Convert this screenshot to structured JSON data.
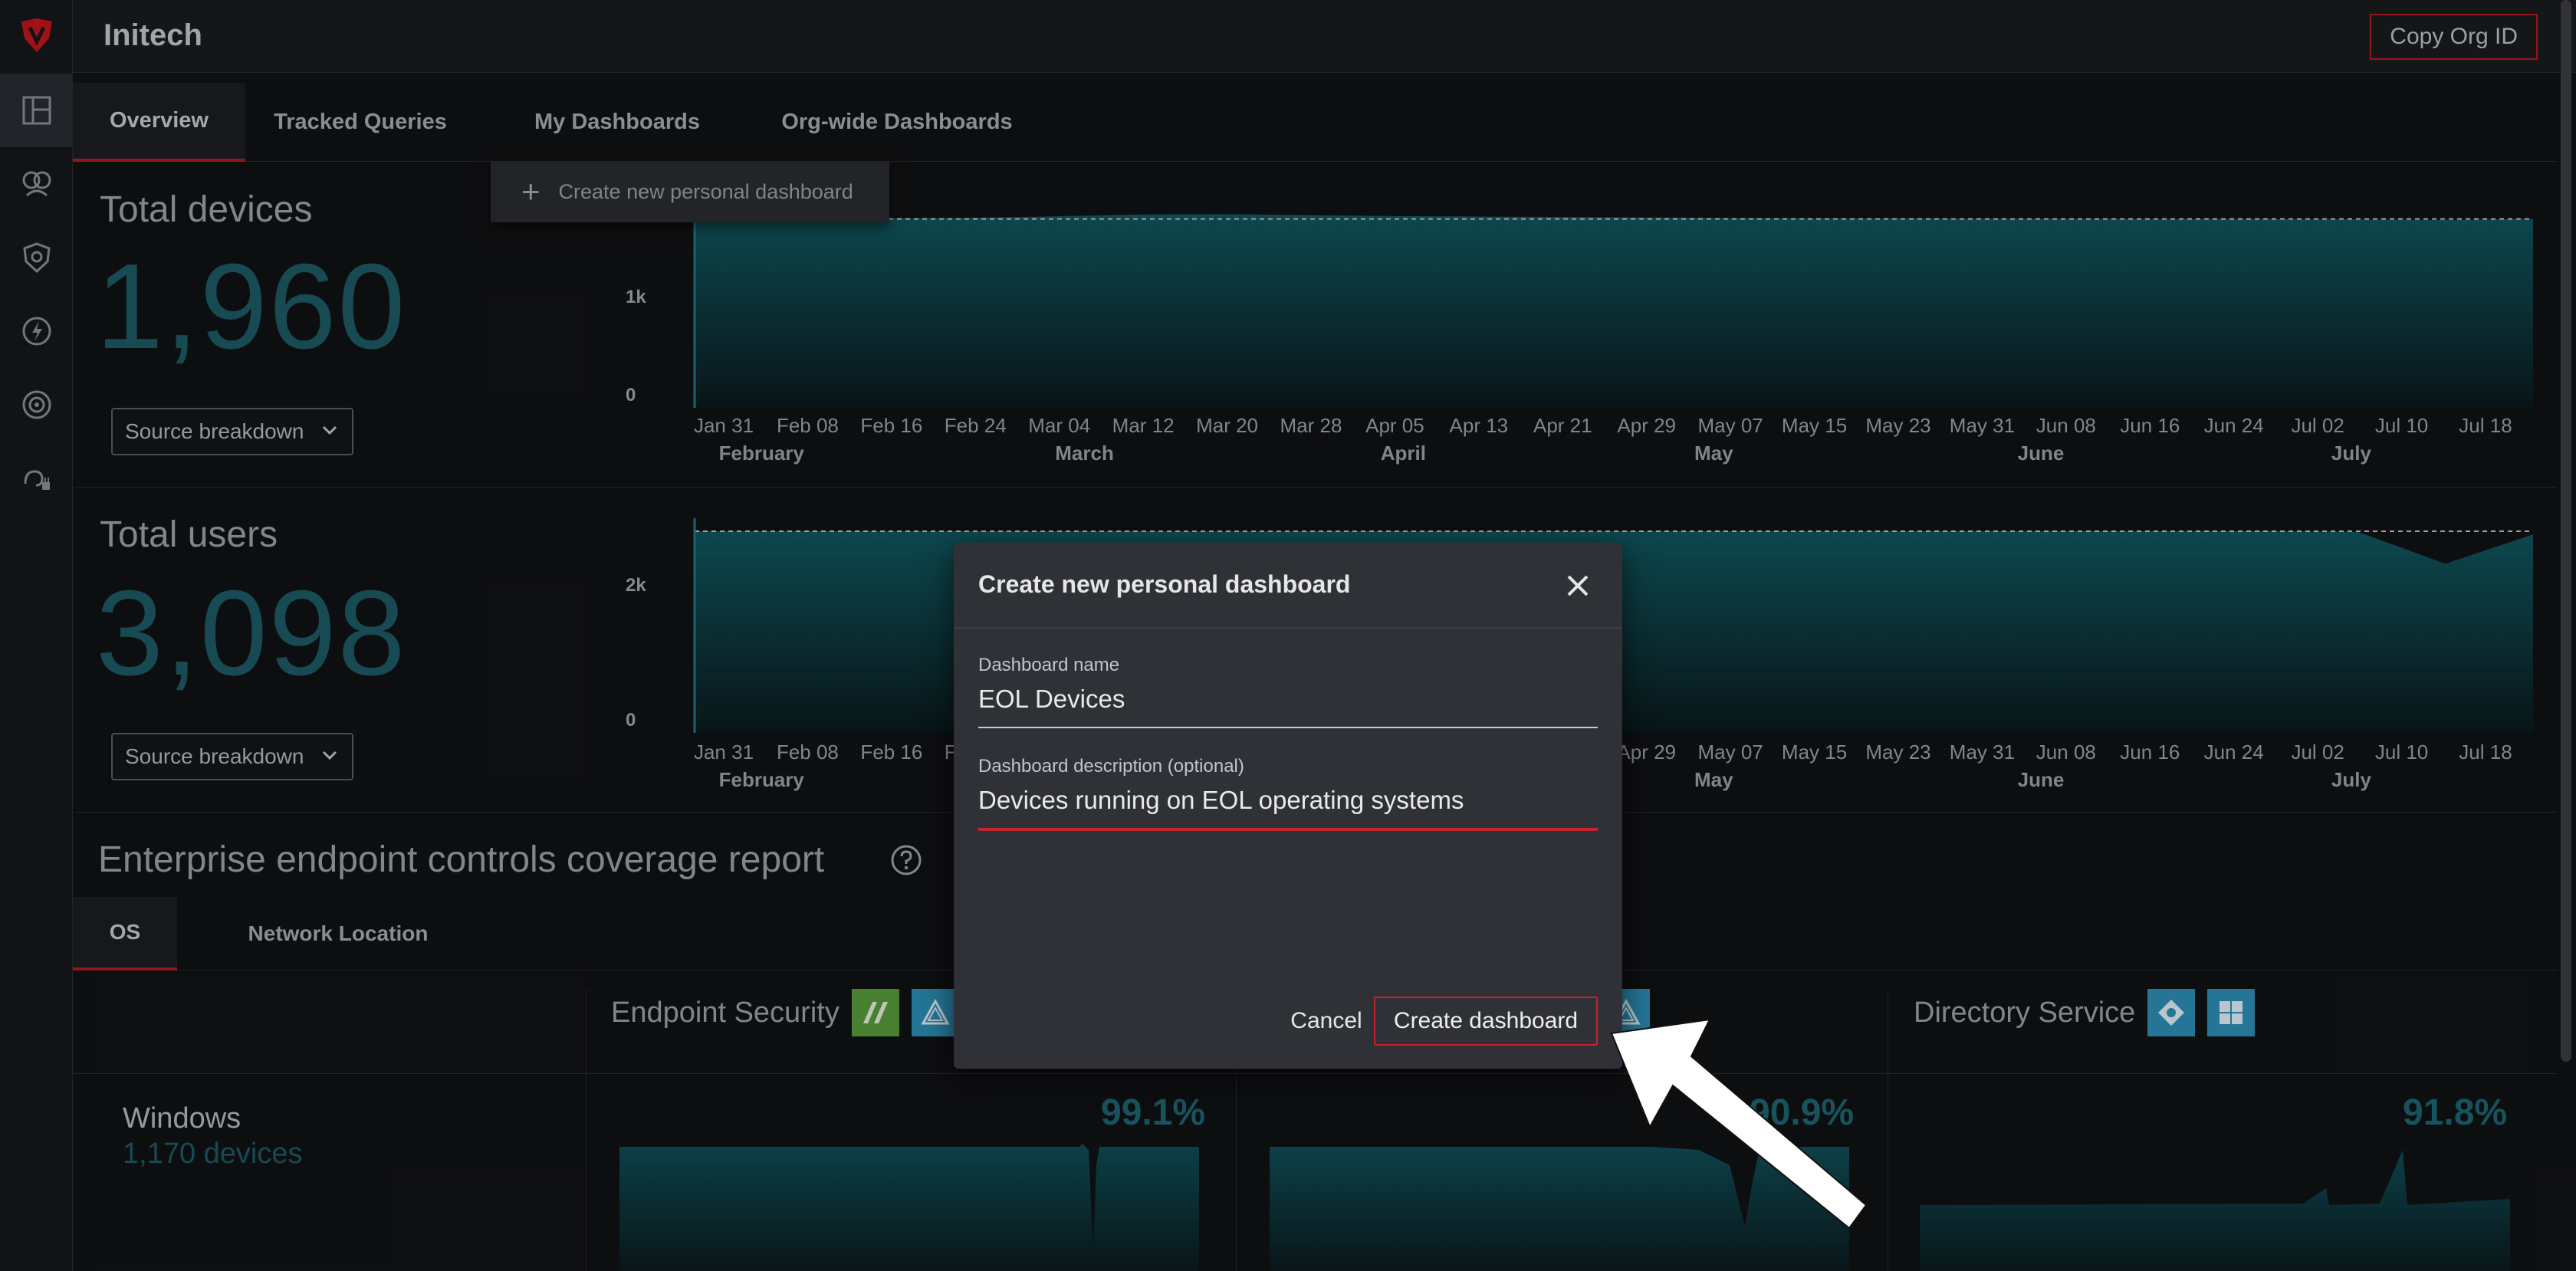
{
  "header": {
    "org_name": "Initech",
    "copy_button": "Copy Org ID"
  },
  "tabs": [
    {
      "label": "Overview",
      "active": true
    },
    {
      "label": "Tracked Queries"
    },
    {
      "label": "My Dashboards"
    },
    {
      "label": "Org-wide Dashboards"
    }
  ],
  "dropdown": {
    "create_personal_label": "Create new personal dashboard"
  },
  "devices_panel": {
    "title": "Total devices",
    "value": "1,960",
    "breakdown_label": "Source breakdown",
    "y_ticks": [
      "1k",
      "0"
    ]
  },
  "users_panel": {
    "title": "Total users",
    "value": "3,098",
    "breakdown_label": "Source breakdown",
    "y_ticks": [
      "2k",
      "0"
    ]
  },
  "chart_data": [
    {
      "type": "area",
      "x": [
        "Jan 31",
        "Feb 08",
        "Feb 16",
        "Feb 24",
        "Mar 04",
        "Mar 12",
        "Mar 20",
        "Mar 28",
        "Apr 05",
        "Apr 13",
        "Apr 21",
        "Apr 29",
        "May 07",
        "May 15",
        "May 23",
        "May 31",
        "Jun 08",
        "Jun 16",
        "Jun 24",
        "Jul 02",
        "Jul 10",
        "Jul 18"
      ],
      "months": [
        "February",
        "March",
        "April",
        "May",
        "June",
        "July"
      ],
      "values": [
        1960,
        1960,
        1965,
        1970,
        1985,
        2005,
        2010,
        2000,
        1990,
        1985,
        1980,
        1975,
        1970,
        1965,
        1965,
        1962,
        1960,
        1958,
        1958,
        1955,
        1950,
        1960
      ],
      "ylim": [
        0,
        2100
      ]
    },
    {
      "type": "area",
      "x": [
        "Jan 31",
        "Feb 08",
        "Feb 16",
        "Feb 24",
        "Mar 04",
        "Mar 12",
        "Mar 20",
        "Mar 28",
        "Apr 05",
        "Apr 13",
        "Apr 21",
        "Apr 29",
        "May 07",
        "May 15",
        "May 23",
        "May 31",
        "Jun 08",
        "Jun 16",
        "Jun 24",
        "Jul 02",
        "Jul 10",
        "Jul 18"
      ],
      "months": [
        "February",
        "March",
        "April",
        "May",
        "June",
        "July"
      ],
      "values": [
        3100,
        3100,
        3100,
        3100,
        3100,
        3100,
        3095,
        3100,
        3100,
        3100,
        3100,
        3100,
        3100,
        3100,
        3100,
        3100,
        3100,
        3100,
        3100,
        3090,
        2600,
        3050
      ],
      "ylim": [
        0,
        3300
      ]
    }
  ],
  "coverage": {
    "title": "Enterprise endpoint controls coverage report",
    "subtabs": [
      {
        "label": "OS",
        "active": true
      },
      {
        "label": "Network Location"
      }
    ],
    "columns": [
      "Endpoint Security",
      "Directory Service"
    ],
    "row": {
      "os": "Windows",
      "count": "1,170 devices"
    },
    "percents": [
      "99.1%",
      "90.9%",
      "91.8%"
    ]
  },
  "modal": {
    "title": "Create new personal dashboard",
    "name_label": "Dashboard name",
    "name_value": "EOL Devices",
    "desc_label": "Dashboard description (optional)",
    "desc_value": "Devices running on EOL operating systems",
    "cancel": "Cancel",
    "submit": "Create dashboard"
  },
  "colors": {
    "accent": "#b31d24",
    "teal": "#1d5b66",
    "area": "#0f4d55"
  }
}
